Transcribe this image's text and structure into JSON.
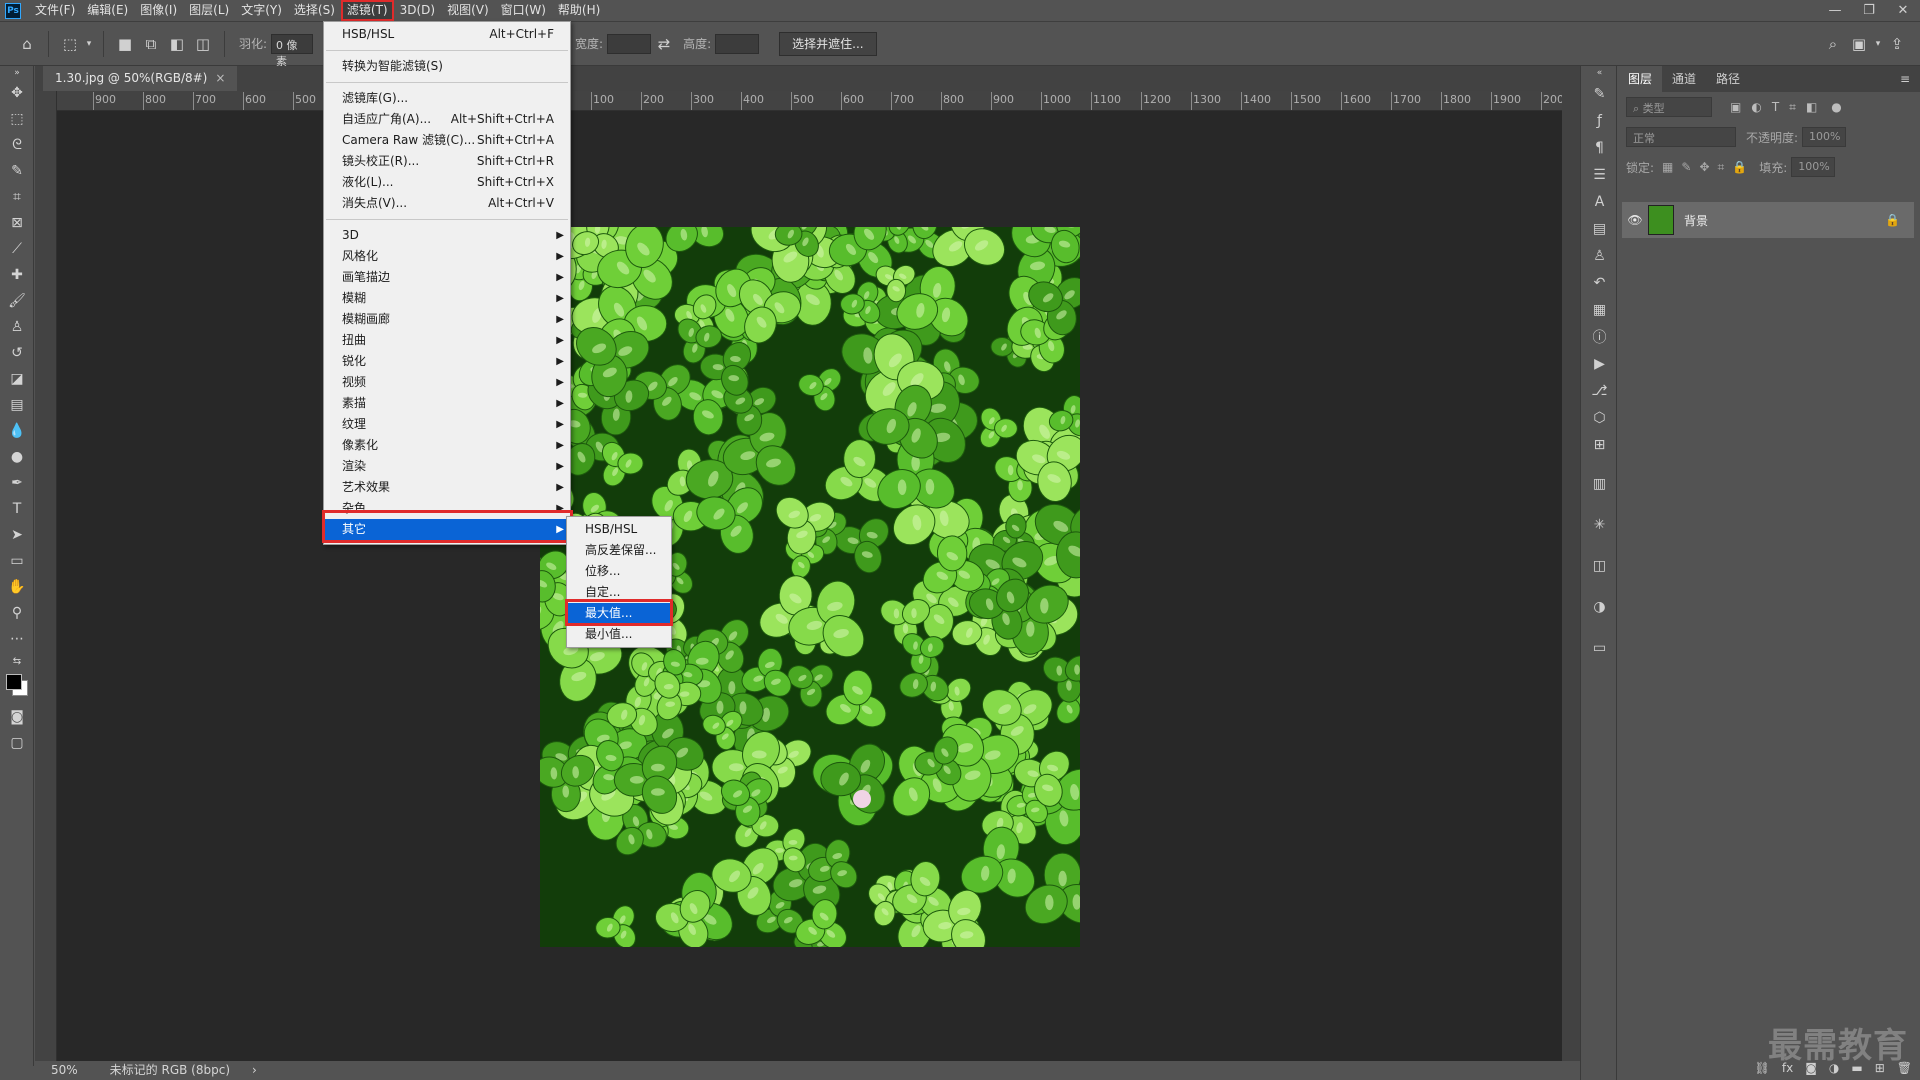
{
  "app": {
    "logo": "Ps"
  },
  "menubar": [
    "文件(F)",
    "编辑(E)",
    "图像(I)",
    "图层(L)",
    "文字(Y)",
    "选择(S)",
    "滤镜(T)",
    "3D(D)",
    "视图(V)",
    "窗口(W)",
    "帮助(H)"
  ],
  "window_controls": {
    "minimize": "—",
    "restore": "❐",
    "close": "✕"
  },
  "options": {
    "feather_label": "羽化:",
    "feather_value": "0 像素",
    "width_label": "宽度:",
    "height_label": "高度:",
    "select_mask_button": "选择并遮住..."
  },
  "document": {
    "tab_title": "1.30.jpg @ 50%(RGB/8#)",
    "tab_close": "×",
    "zoom": "50%",
    "color_info": "未标记的 RGB (8bpc)",
    "status_arrow": "›"
  },
  "ruler": {
    "labels": [
      "900",
      "800",
      "700",
      "600",
      "500",
      "100",
      "200",
      "300",
      "400",
      "500",
      "600",
      "700",
      "800",
      "900",
      "1000",
      "1100",
      "1200",
      "1300",
      "1400",
      "1500",
      "1600",
      "1700",
      "1800",
      "1900",
      "200"
    ]
  },
  "filter_menu": {
    "top": [
      {
        "label": "HSB/HSL",
        "shortcut": "Alt+Ctrl+F"
      },
      {
        "label": "转换为智能滤镜(S)",
        "shortcut": ""
      }
    ],
    "middle": [
      {
        "label": "滤镜库(G)...",
        "shortcut": ""
      },
      {
        "label": "自适应广角(A)...",
        "shortcut": "Alt+Shift+Ctrl+A"
      },
      {
        "label": "Camera Raw 滤镜(C)...",
        "shortcut": "Shift+Ctrl+A"
      },
      {
        "label": "镜头校正(R)...",
        "shortcut": "Shift+Ctrl+R"
      },
      {
        "label": "液化(L)...",
        "shortcut": "Shift+Ctrl+X"
      },
      {
        "label": "消失点(V)...",
        "shortcut": "Alt+Ctrl+V"
      }
    ],
    "submenus": [
      "3D",
      "风格化",
      "画笔描边",
      "模糊",
      "模糊画廊",
      "扭曲",
      "锐化",
      "视频",
      "素描",
      "纹理",
      "像素化",
      "渲染",
      "艺术效果",
      "杂色",
      "其它"
    ]
  },
  "other_submenu": [
    "HSB/HSL",
    "高反差保留...",
    "位移...",
    "自定...",
    "最大值...",
    "最小值..."
  ],
  "layers_panel": {
    "tabs": [
      "图层",
      "通道",
      "路径"
    ],
    "filter_placeholder": "类型",
    "blend_mode": "正常",
    "opacity_label": "不透明度:",
    "opacity_value": "100%",
    "lock_label": "锁定:",
    "fill_label": "填充:",
    "fill_value": "100%",
    "layer_name": "背景",
    "bottom_icons": [
      "link-icon",
      "fx-icon",
      "mask-icon",
      "adjustment-icon",
      "folder-icon",
      "new-layer-icon",
      "trash-icon"
    ],
    "fx_text": "fx"
  },
  "watermark": "最需教育"
}
